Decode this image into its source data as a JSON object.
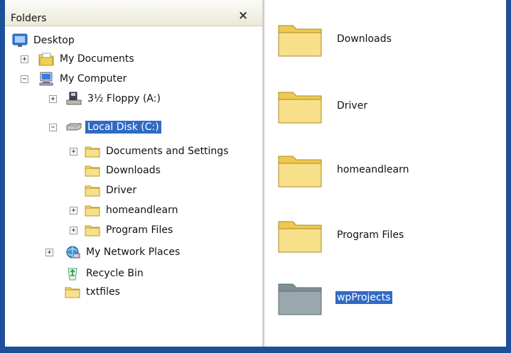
{
  "folders_pane": {
    "title": "Folders",
    "close_glyph": "×",
    "tree": [
      {
        "label": "Desktop",
        "icon": "desktop-icon"
      },
      {
        "label": "My Documents",
        "icon": "my-documents-icon",
        "expander": "+"
      },
      {
        "label": "My Computer",
        "icon": "my-computer-icon",
        "expander": "−"
      },
      {
        "label": "3½ Floppy (A:)",
        "icon": "floppy-drive-icon",
        "expander": "+"
      },
      {
        "label": "Local Disk (C:)",
        "icon": "hard-disk-icon",
        "expander": "−",
        "selected": true
      },
      {
        "label": "Documents and Settings",
        "icon": "folder-icon",
        "expander": "+"
      },
      {
        "label": "Downloads",
        "icon": "folder-icon"
      },
      {
        "label": "Driver",
        "icon": "folder-icon"
      },
      {
        "label": "homeandlearn",
        "icon": "folder-icon",
        "expander": "+"
      },
      {
        "label": "Program Files",
        "icon": "folder-icon",
        "expander": "+"
      },
      {
        "label": "My Network Places",
        "icon": "network-places-icon",
        "expander": "+"
      },
      {
        "label": "Recycle Bin",
        "icon": "recycle-bin-icon"
      },
      {
        "label": "txtfiles",
        "icon": "folder-icon"
      }
    ]
  },
  "content": {
    "items": [
      {
        "label": "Downloads",
        "icon": "folder-icon"
      },
      {
        "label": "Driver",
        "icon": "folder-icon"
      },
      {
        "label": "homeandlearn",
        "icon": "folder-icon"
      },
      {
        "label": "Program Files",
        "icon": "folder-icon"
      },
      {
        "label": "wpProjects",
        "icon": "folder-icon",
        "selected": true
      }
    ]
  },
  "colors": {
    "selection": "#316ac5",
    "window_border": "#1e4f9a",
    "folder_yellow": "#f5d96b",
    "folder_gray": "#9aa7ad"
  }
}
